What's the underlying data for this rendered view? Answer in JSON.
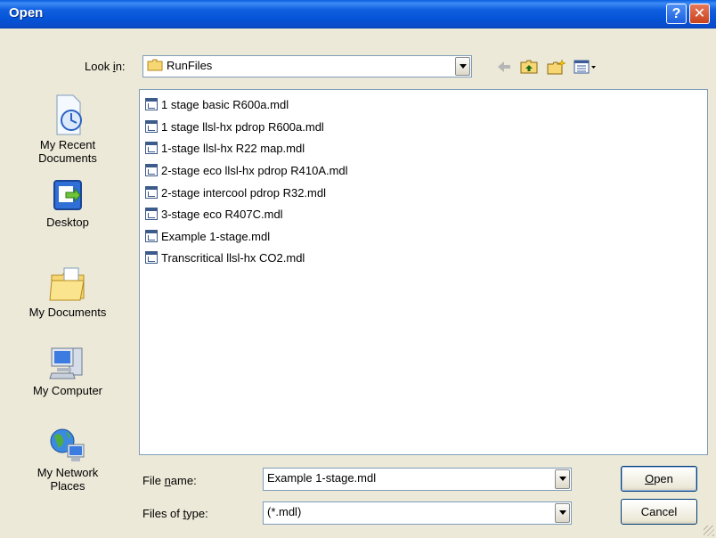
{
  "window": {
    "title": "Open",
    "help_glyph": "?",
    "close_glyph": "✕"
  },
  "look_in": {
    "label_pre": "Look ",
    "label_key": "i",
    "label_post": "n:",
    "value": "RunFiles",
    "icon": "folder-icon"
  },
  "toolbar": {
    "icons": [
      "back-arrow-icon",
      "up-one-level-icon",
      "new-folder-icon",
      "view-menu-icon"
    ]
  },
  "places": [
    {
      "label": "My Recent\nDocuments",
      "icon": "recent-documents-icon"
    },
    {
      "label": "Desktop",
      "icon": "desktop-icon"
    },
    {
      "label": "My Documents",
      "icon": "my-documents-icon"
    },
    {
      "label": "My Computer",
      "icon": "my-computer-icon"
    },
    {
      "label": "My Network\nPlaces",
      "icon": "network-places-icon"
    }
  ],
  "files": [
    "1 stage basic R600a.mdl",
    "1 stage llsl-hx pdrop R600a.mdl",
    "1-stage llsl-hx R22 map.mdl",
    "2-stage eco llsl-hx pdrop R410A.mdl",
    "2-stage intercool pdrop R32.mdl",
    "3-stage eco R407C.mdl",
    "Example 1-stage.mdl",
    "Transcritical llsl-hx CO2.mdl"
  ],
  "file_name": {
    "label_pre": "File ",
    "label_key": "n",
    "label_post": "ame:",
    "value": "Example 1-stage.mdl"
  },
  "file_type": {
    "label_pre": "Files of ",
    "label_key": "t",
    "label_post": "ype:",
    "value": "(*.mdl)"
  },
  "buttons": {
    "open_key": "O",
    "open_rest": "pen",
    "cancel": "Cancel"
  }
}
